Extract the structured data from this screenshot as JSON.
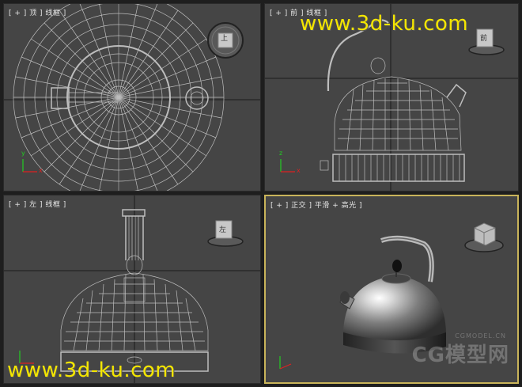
{
  "viewports": {
    "top": {
      "label": "[ + ] 顶 ] 线框 ]",
      "cube_face": "上"
    },
    "front": {
      "label": "[ + ] 前 ] 线框 ]",
      "cube_face": "前"
    },
    "left": {
      "label": "[ + ] 左 ] 线框 ]",
      "cube_face": "左"
    },
    "perspective": {
      "label": "[ + ] 正交 ] 平滑 + 高光 ]",
      "cube_face": "左"
    }
  },
  "watermark": {
    "top_right": "www.3d-ku.com",
    "bottom_left": "www.3d-ku.com",
    "cgmodel_small": "CGMODEL.CN",
    "cgmodel_big": "CG模型网"
  },
  "axis_labels": {
    "x": "x",
    "y": "y",
    "z": "z"
  },
  "colors": {
    "viewport_bg": "#454545",
    "active_border": "#c9b45a",
    "wire": "#bdbdbd",
    "watermark": "#f4e600"
  }
}
